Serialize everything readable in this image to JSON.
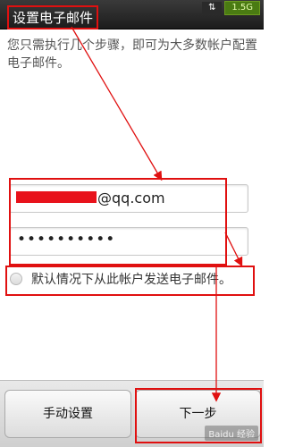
{
  "title": "设置电子邮件",
  "status_bar": {
    "network_icon": "updown-arrows-icon",
    "storage": "1.5G"
  },
  "description": "您只需执行几个步骤，即可为大多数帐户配置电子邮件。",
  "email_field": {
    "domain": "@qq.com"
  },
  "password_field": {
    "masked": "••••••••••"
  },
  "checkbox_label": "默认情况下从此帐户发送电子邮件。",
  "buttons": {
    "manual": "手动设置",
    "next": "下一步"
  },
  "watermark": "Baidu 经验",
  "colors": {
    "highlight": "#e01010",
    "storage_badge": "#4a7b12"
  }
}
